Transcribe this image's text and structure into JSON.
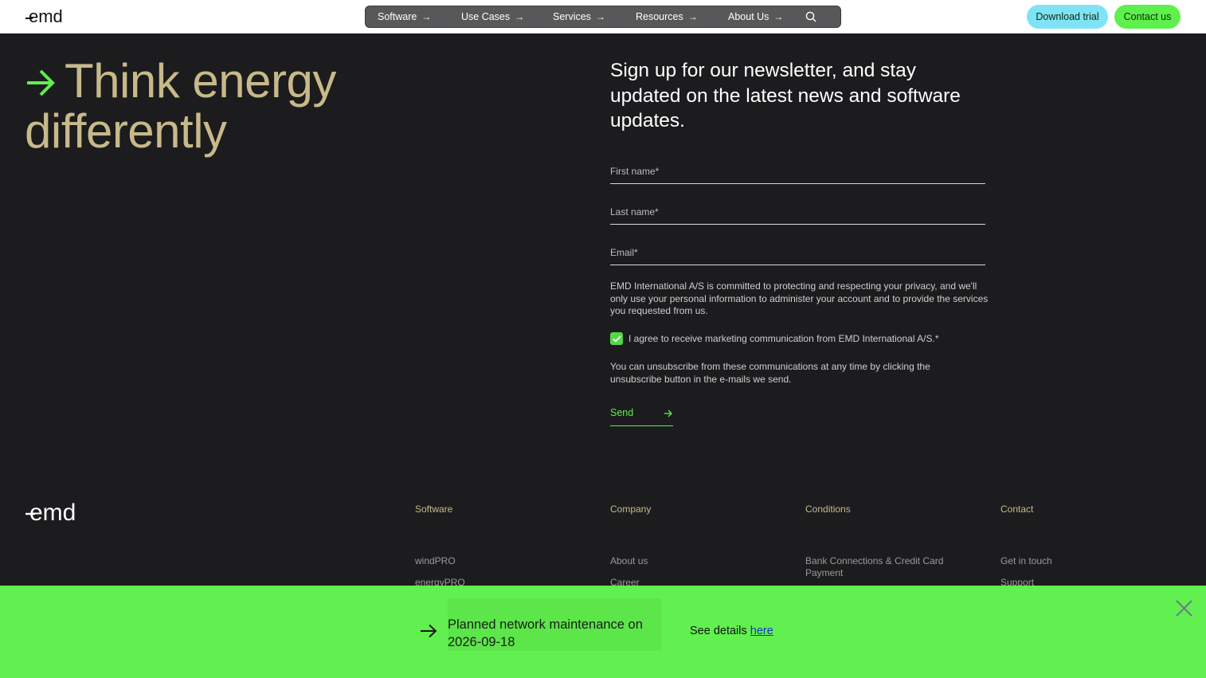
{
  "header": {
    "logo_text": "emd",
    "nav": [
      {
        "label": "Software"
      },
      {
        "label": "Use Cases"
      },
      {
        "label": "Services"
      },
      {
        "label": "Resources"
      },
      {
        "label": "About Us"
      }
    ],
    "download_trial": "Download trial",
    "contact_us": "Contact us"
  },
  "hero": {
    "line1": "Think energy",
    "line2": "differently"
  },
  "newsletter": {
    "heading": "Sign up for our newsletter, and stay updated on the latest news and software updates.",
    "first_name_placeholder": "First name*",
    "last_name_placeholder": "Last name*",
    "email_placeholder": "Email*",
    "privacy": "EMD International A/S is committed to protecting and respecting your privacy, and we'll only use your personal information to administer your account and to provide the services you requested from us.",
    "consent": "I agree to receive marketing communication from EMD International A/S.*",
    "consent_checked": true,
    "unsubscribe": "You can unsubscribe from these communications at any time by clicking the unsubscribe button in the e-mails we send.",
    "send": "Send"
  },
  "footer": {
    "logo_text": "emd",
    "columns": [
      {
        "heading": "Software",
        "links": [
          "windPRO",
          "energyPRO"
        ]
      },
      {
        "heading": "Company",
        "links": [
          "About us",
          "Career"
        ]
      },
      {
        "heading": "Conditions",
        "links": [
          "Bank Connections & Credit Card Payment"
        ]
      },
      {
        "heading": "Contact",
        "links": [
          "Get in touch",
          "Support"
        ]
      }
    ]
  },
  "banner": {
    "message": "Planned network maintenance on 2026-09-18",
    "details_prefix": "See details",
    "details_link": "here"
  },
  "colors": {
    "accent_green": "#5ef04c",
    "trial_cyan": "#7fe3f5",
    "hero_gold": "#c8b98a",
    "background": "#1c1c1e"
  }
}
